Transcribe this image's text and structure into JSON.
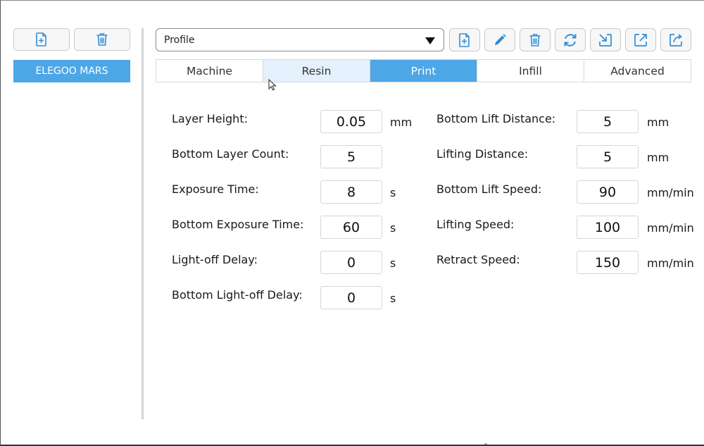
{
  "left_panel": {
    "printers": [
      "ELEGOO MARS"
    ],
    "add_icon": "file-plus-icon",
    "delete_icon": "trash-icon"
  },
  "profile": {
    "selected": "Profile"
  },
  "toolbar": {
    "icons": [
      "file-plus-icon",
      "pencil-icon",
      "trash-icon",
      "refresh-icon",
      "import-icon",
      "export-icon",
      "share-icon"
    ]
  },
  "tabs": [
    "Machine",
    "Resin",
    "Print",
    "Infill",
    "Advanced"
  ],
  "active_tab": "Print",
  "hover_tab": "Resin",
  "fields_left": [
    {
      "label": "Layer Height:",
      "value": "0.05",
      "unit": "mm"
    },
    {
      "label": "Bottom Layer Count:",
      "value": "5",
      "unit": ""
    },
    {
      "label": "Exposure Time:",
      "value": "8",
      "unit": "s"
    },
    {
      "label": "Bottom Exposure Time:",
      "value": "60",
      "unit": "s"
    },
    {
      "label": "Light-off Delay:",
      "value": "0",
      "unit": "s"
    },
    {
      "label": "Bottom Light-off Delay:",
      "value": "0",
      "unit": "s"
    }
  ],
  "fields_right": [
    {
      "label": "Bottom Lift Distance:",
      "value": "5",
      "unit": "mm"
    },
    {
      "label": "Lifting Distance:",
      "value": "5",
      "unit": "mm"
    },
    {
      "label": "Bottom Lift Speed:",
      "value": "90",
      "unit": "mm/min"
    },
    {
      "label": "Lifting Speed:",
      "value": "100",
      "unit": "mm/min"
    },
    {
      "label": "Retract Speed:",
      "value": "150",
      "unit": "mm/min"
    }
  ],
  "colors": {
    "accent": "#4da6e6",
    "hover": "#e4f0fb",
    "icon": "#2e8fd8"
  }
}
